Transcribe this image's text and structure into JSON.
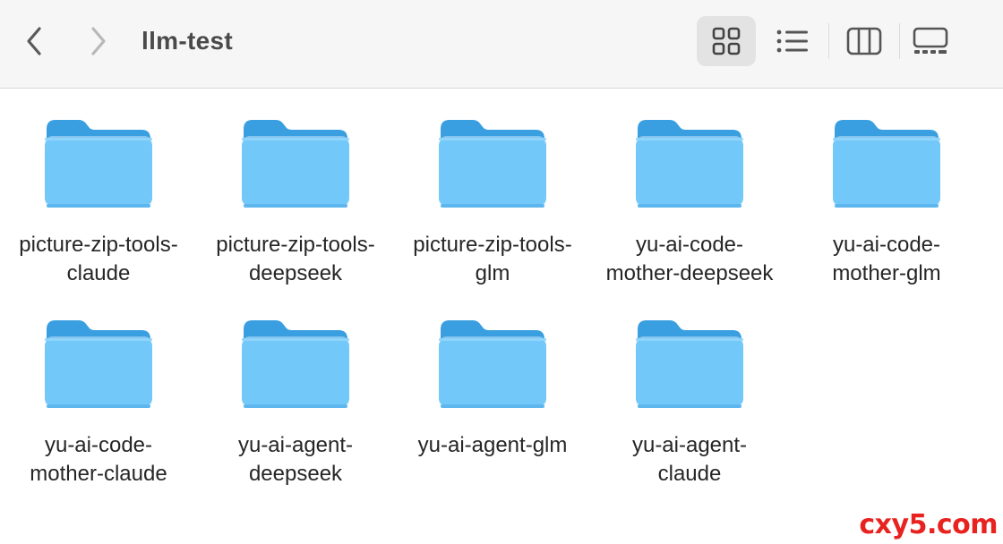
{
  "window": {
    "title": "llm-test"
  },
  "toolbar": {
    "back_icon": "chevron-left-icon",
    "forward_icon": "chevron-right-icon",
    "views": [
      {
        "name": "icon-view",
        "icon": "grid-icon",
        "selected": true
      },
      {
        "name": "list-view",
        "icon": "list-icon",
        "selected": false
      },
      {
        "name": "column-view",
        "icon": "columns-icon",
        "selected": false
      },
      {
        "name": "gallery-view",
        "icon": "gallery-icon",
        "selected": false
      }
    ]
  },
  "folders": [
    {
      "label": "picture-zip-tools-\nclaude"
    },
    {
      "label": "picture-zip-tools-\ndeepseek"
    },
    {
      "label": "picture-zip-tools-\nglm"
    },
    {
      "label": "yu-ai-code-\nmother-deepseek"
    },
    {
      "label": "yu-ai-code-\nmother-glm"
    },
    {
      "label": "yu-ai-code-\nmother-claude"
    },
    {
      "label": "yu-ai-agent-\ndeepseek"
    },
    {
      "label": "yu-ai-agent-glm"
    },
    {
      "label": "yu-ai-agent-\nclaude"
    }
  ],
  "colors": {
    "folder_body": "#72c8f8",
    "folder_back": "#3aa0e0",
    "watermark": "#e8231f"
  },
  "watermark": "cxy5.com"
}
